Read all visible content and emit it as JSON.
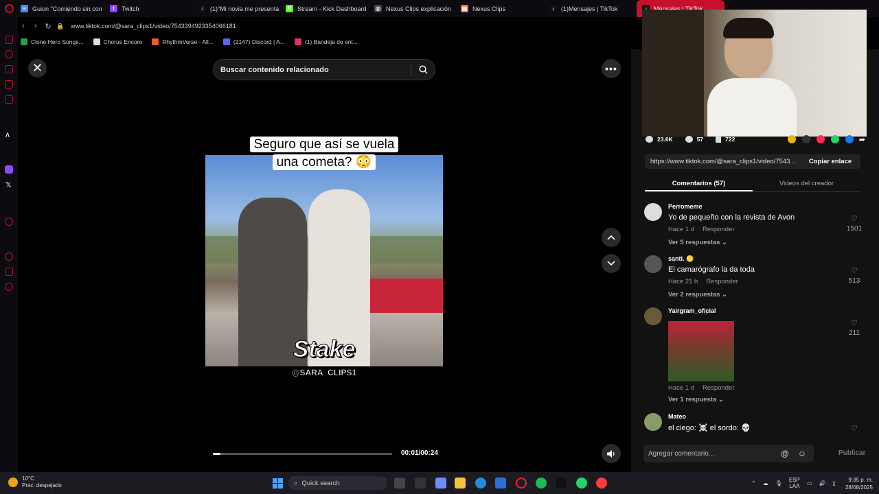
{
  "browser": {
    "tabs": [
      {
        "label": "Guion \"Comiendo sin con",
        "color": "#4a8cf7",
        "glyph": "≡"
      },
      {
        "label": "Twitch",
        "color": "#9146ff",
        "glyph": "t"
      },
      {
        "label": "(1)\"Mi novia me presenta",
        "color": "#111111",
        "glyph": "♪"
      },
      {
        "label": "Stream - Kick Dashboard",
        "color": "#53fc18",
        "glyph": "K"
      },
      {
        "label": "Nexus Clips explicación",
        "color": "#444444",
        "glyph": "◎"
      },
      {
        "label": "Nexus Clips",
        "color": "#ff6d3a",
        "glyph": "▤"
      },
      {
        "label": "(1)Mensajes | TikTok",
        "color": "#111111",
        "glyph": "♪"
      },
      {
        "label": "Mensajes | TikTok",
        "color": "#111111",
        "glyph": "♪"
      }
    ],
    "url": "www.tiktok.com/@sara_clips1/video/7543394923354066181",
    "bookmarks": [
      {
        "label": "Clone Hero Songs...",
        "color": "#2e9e44"
      },
      {
        "label": "Chorus Encore",
        "color": "#dddddd"
      },
      {
        "label": "RhythmVerse - All...",
        "color": "#e85d2a"
      },
      {
        "label": "(2147) Discord | A...",
        "color": "#5865f2"
      },
      {
        "label": "(1) Bandeja de ent...",
        "color": "#e1306c"
      }
    ]
  },
  "video": {
    "search_placeholder": "Buscar contenido relacionado",
    "caption": "Seguro que así se vuela una cometa? 😳",
    "watermark_brand": "Stake",
    "watermark_handle": "@SARA_CLIPS1",
    "progress_fraction": 0.042,
    "timecode": "00:01/00:24"
  },
  "panel": {
    "stats": {
      "likes": "23.6K",
      "comments": "57",
      "saves": "722"
    },
    "copy_url": "https://www.tiktok.com/@sara_clips1/video/7543...",
    "copy_label": "Copiar enlace",
    "tabs": [
      "Comentarios (57)",
      "Videos del creador"
    ],
    "comments": [
      {
        "user": "Perromeme",
        "text": "Yo de pequeño con la revista de Avon",
        "time": "Hace 1 d",
        "reply": "Responder",
        "likes": "1501",
        "more": "Ver 5 respuestas"
      },
      {
        "user": "santi. 🟡",
        "text": "El camarógrafo la da toda",
        "time": "Hace 21 h",
        "reply": "Responder",
        "likes": "513",
        "more": "Ver 2 respuestas"
      },
      {
        "user": "Yairgram_oficial",
        "text": "",
        "time": "Hace 1 d",
        "reply": "Responder",
        "likes": "211",
        "more": "Ver 1 respuesta"
      },
      {
        "user": "Mateo",
        "text": "el ciego: ☠️ el sordo: 💀",
        "time": "",
        "reply": "",
        "likes": "",
        "more": ""
      }
    ],
    "comment_placeholder": "Agregar comentario...",
    "publish_label": "Publicar"
  },
  "taskbar": {
    "temp": "10°C",
    "weather": "Prac. despejado",
    "search": "Quick search",
    "lang1": "ESP",
    "lang2": "LAA",
    "time": "9:35 p. m.",
    "date": "28/08/2025"
  }
}
